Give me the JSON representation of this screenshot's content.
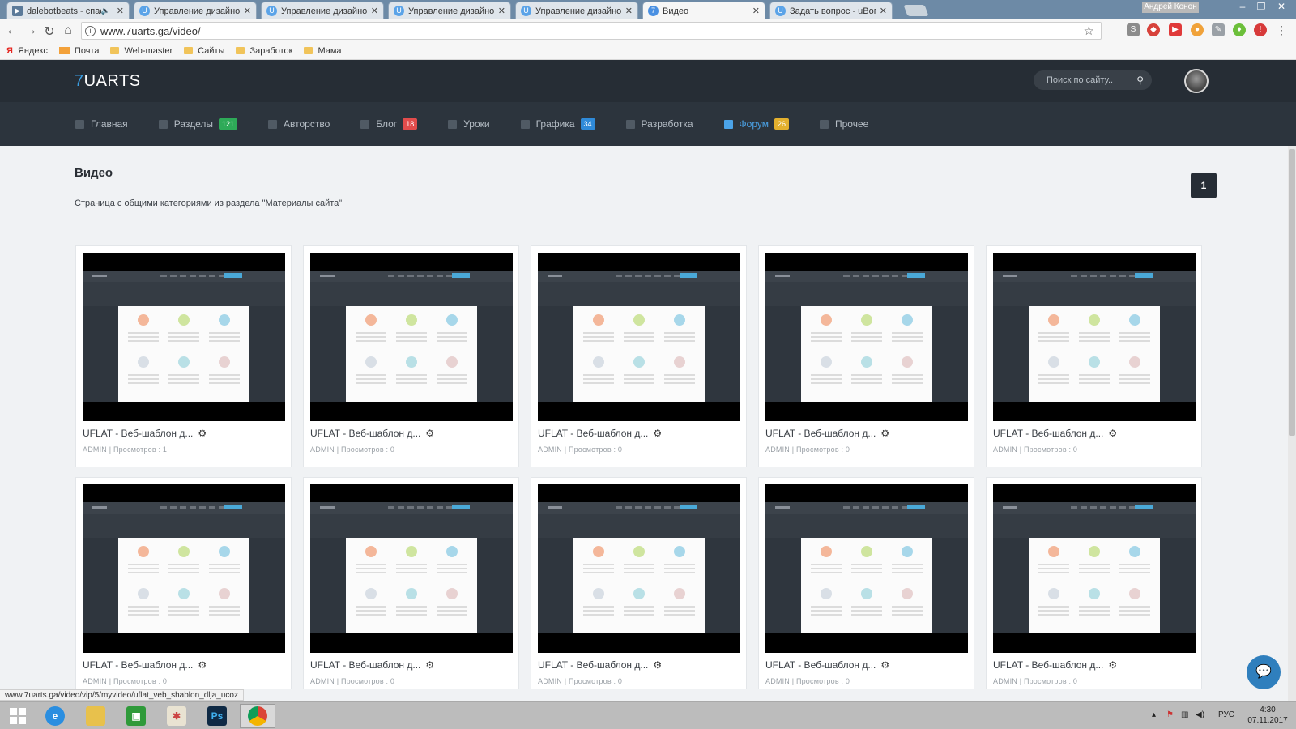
{
  "browser": {
    "tabs": [
      {
        "title": "dalebotbeats - спаси",
        "favicon": "youtube-icon",
        "audio": true
      },
      {
        "title": "Управление дизайном",
        "favicon": "ucoz-icon"
      },
      {
        "title": "Управление дизайном",
        "favicon": "ucoz-icon"
      },
      {
        "title": "Управление дизайном",
        "favicon": "ucoz-icon"
      },
      {
        "title": "Управление дизайном",
        "favicon": "ucoz-icon"
      },
      {
        "title": "Видео",
        "favicon": "7uarts-icon",
        "active": true
      },
      {
        "title": "Задать вопрос - uВопрос",
        "favicon": "ucoz-icon"
      }
    ],
    "window_user": "Андрей Конон",
    "url": "www.7uarts.ga/video/",
    "bookmarks": [
      {
        "label": "Яндекс",
        "icon": "yandex-icon"
      },
      {
        "label": "Почта",
        "icon": "mail-icon"
      },
      {
        "label": "Web-master",
        "icon": "folder-icon"
      },
      {
        "label": "Сайты",
        "icon": "folder-icon"
      },
      {
        "label": "Заработок",
        "icon": "folder-icon"
      },
      {
        "label": "Мама",
        "icon": "folder-icon"
      }
    ],
    "status_url": "www.7uarts.ga/video/vip/5/myvideo/uflat_veb_shablon_dlja_ucoz"
  },
  "site": {
    "logo_seven": "7",
    "logo_text": "UARTS",
    "search_placeholder": "Поиск по сайту..",
    "nav": [
      {
        "label": "Главная",
        "icon": "home-icon"
      },
      {
        "label": "Разделы",
        "icon": "pie-chart-icon",
        "badge": "121",
        "badge_color": "#2eaa58"
      },
      {
        "label": "Авторство",
        "icon": "document-icon"
      },
      {
        "label": "Блог",
        "icon": "rss-icon",
        "badge": "18",
        "badge_color": "#e24c4c"
      },
      {
        "label": "Уроки",
        "icon": "graduation-cap-icon"
      },
      {
        "label": "Графика",
        "icon": "image-icon",
        "badge": "34",
        "badge_color": "#2f8ad8"
      },
      {
        "label": "Разработка",
        "icon": "code-icon"
      },
      {
        "label": "Форум",
        "icon": "forum-icon",
        "badge": "26",
        "badge_color": "#e3b02e",
        "active": true
      },
      {
        "label": "Прочее",
        "icon": "file-icon"
      }
    ]
  },
  "page": {
    "title": "Видео",
    "description": "Страница с общими категориями из раздела \"Материалы сайта\"",
    "current_page": "1"
  },
  "videos": [
    {
      "title": "UFLAT - Веб-шаблон д...",
      "meta": "ADMIN | Просмотров : 1"
    },
    {
      "title": "UFLAT - Веб-шаблон д...",
      "meta": "ADMIN | Просмотров : 0"
    },
    {
      "title": "UFLAT - Веб-шаблон д...",
      "meta": "ADMIN | Просмотров : 0"
    },
    {
      "title": "UFLAT - Веб-шаблон д...",
      "meta": "ADMIN | Просмотров : 0"
    },
    {
      "title": "UFLAT - Веб-шаблон д...",
      "meta": "ADMIN | Просмотров : 0"
    },
    {
      "title": "UFLAT - Веб-шаблон д...",
      "meta": "ADMIN | Просмотров : 0"
    },
    {
      "title": "UFLAT - Веб-шаблон д...",
      "meta": "ADMIN | Просмотров : 0"
    },
    {
      "title": "UFLAT - Веб-шаблон д...",
      "meta": "ADMIN | Просмотров : 0"
    },
    {
      "title": "UFLAT - Веб-шаблон д...",
      "meta": "ADMIN | Просмотров : 0"
    },
    {
      "title": "UFLAT - Веб-шаблон д...",
      "meta": "ADMIN | Просмотров : 0"
    }
  ],
  "taskbar": {
    "apps": [
      "windows-start-icon",
      "internet-explorer-icon",
      "file-explorer-icon",
      "store-icon",
      "paint-icon",
      "photoshop-icon",
      "chrome-icon"
    ],
    "photoshop_label": "Ps",
    "lang": "РУС",
    "time": "4:30",
    "date": "07.11.2017"
  }
}
